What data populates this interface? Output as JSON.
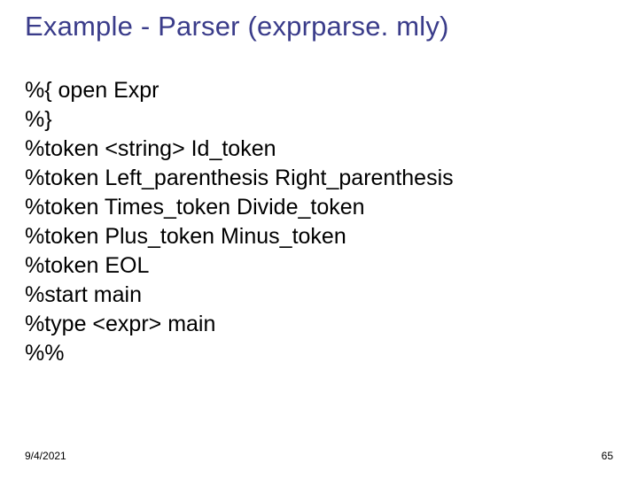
{
  "title": "Example - Parser (exprparse. mly)",
  "code": {
    "l0": "%{ open Expr",
    "l1": "%}",
    "l2": "%token <string> Id_token",
    "l3": "%token Left_parenthesis Right_parenthesis",
    "l4": "%token Times_token Divide_token",
    "l5": "%token Plus_token Minus_token",
    "l6": "%token EOL",
    "l7": "%start main",
    "l8": "%type <expr> main",
    "l9": "%%"
  },
  "footer": {
    "date": "9/4/2021",
    "page": "65"
  }
}
